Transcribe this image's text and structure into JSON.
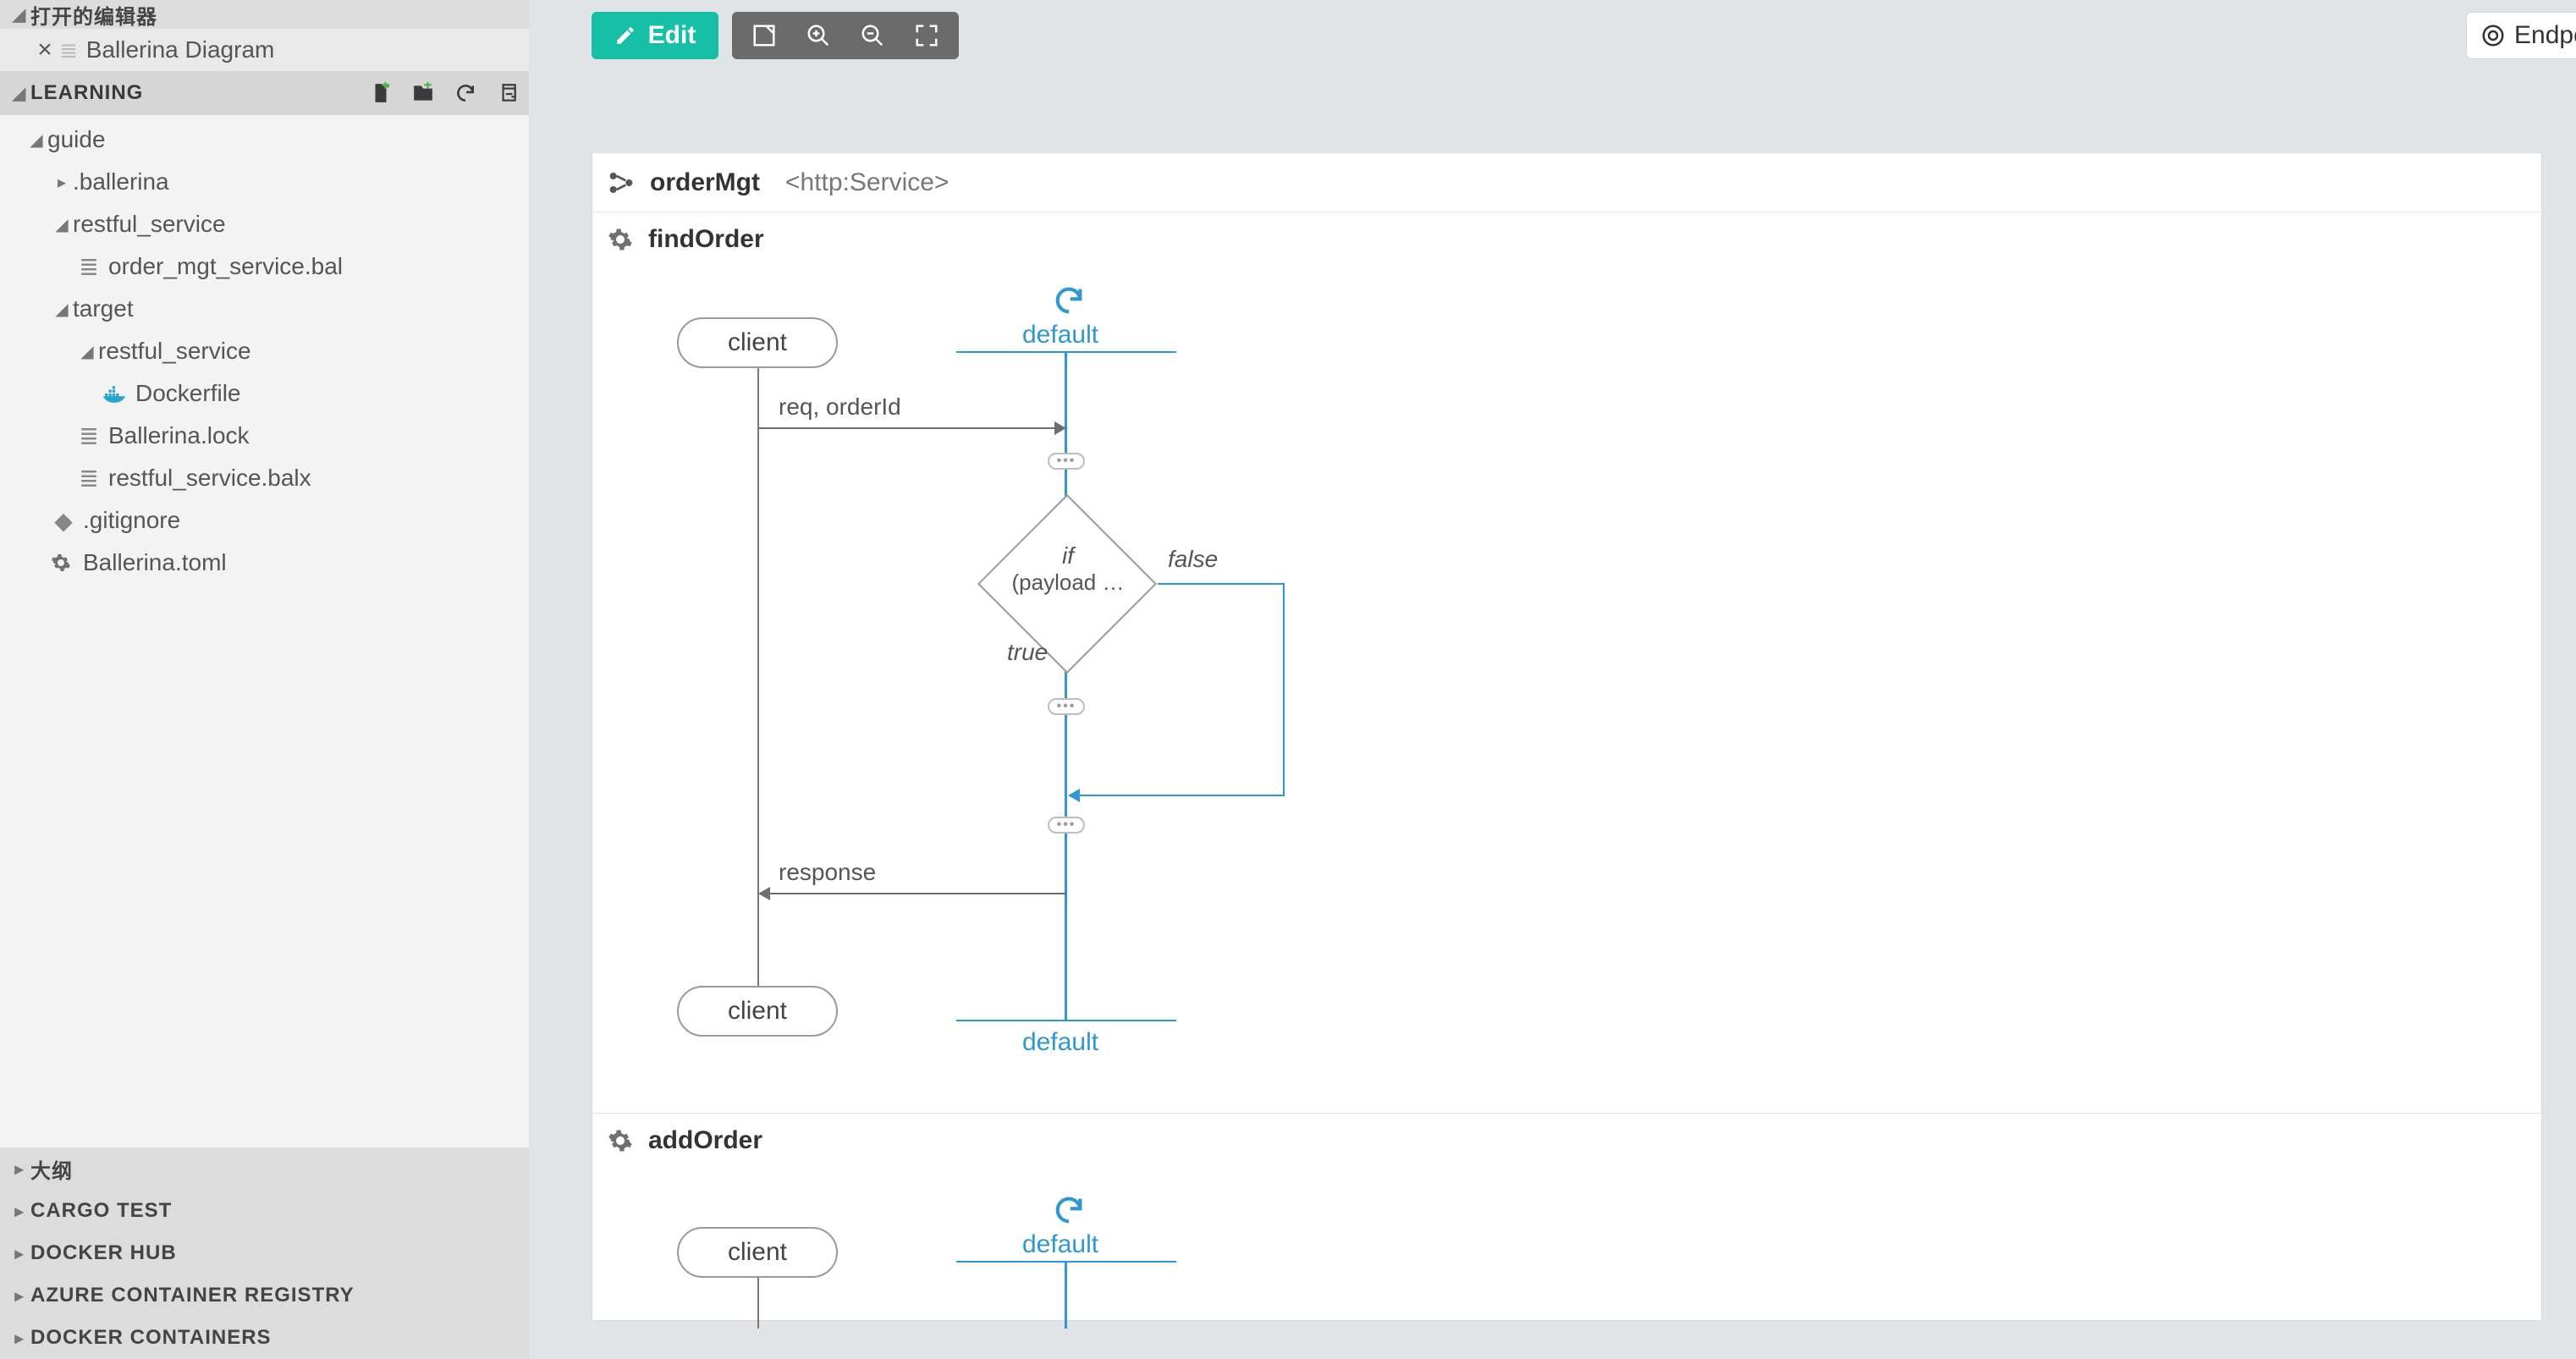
{
  "sidebar": {
    "open_editors_title": "打开的编辑器",
    "open_editor_item": "Ballerina Diagram",
    "project_title": "LEARNING",
    "tree": {
      "guide": "guide",
      "ballerina": ".ballerina",
      "restful_service": "restful_service",
      "order_mgt": "order_mgt_service.bal",
      "target": "target",
      "restful_service_2": "restful_service",
      "dockerfile": "Dockerfile",
      "ballerina_lock": "Ballerina.lock",
      "restful_balx": "restful_service.balx",
      "gitignore": ".gitignore",
      "ballerina_toml": "Ballerina.toml"
    },
    "bottom": {
      "outline": "大纲",
      "cargo_test": "CARGO TEST",
      "docker_hub": "DOCKER HUB",
      "acr": "AZURE CONTAINER REGISTRY",
      "docker_containers": "DOCKER CONTAINERS"
    }
  },
  "toolbar": {
    "edit": "Edit",
    "endpoints": "Endpoi"
  },
  "service": {
    "name": "orderMgt",
    "annotation": "<http:Service>"
  },
  "resource1": {
    "name": "findOrder",
    "client": "client",
    "default": "default",
    "req_label": "req, orderId",
    "if": "if",
    "payload": "(payload …",
    "true": "true",
    "false": "false",
    "response": "response"
  },
  "resource2": {
    "name": "addOrder",
    "client": "client",
    "default": "default"
  }
}
